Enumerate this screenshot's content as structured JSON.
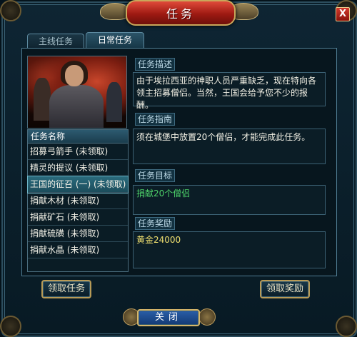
{
  "window": {
    "title": "任务",
    "close_label": "X"
  },
  "tabs": [
    {
      "label": "主线任务",
      "active": false
    },
    {
      "label": "日常任务",
      "active": true
    }
  ],
  "quest_list": {
    "header": "任务名称",
    "items": [
      {
        "label": "招募弓箭手 (未领取)",
        "selected": false
      },
      {
        "label": "精灵的提议 (未领取)",
        "selected": false
      },
      {
        "label": "王国的征召 (一) (未领取)",
        "selected": true
      },
      {
        "label": "捐献木材 (未领取)",
        "selected": false
      },
      {
        "label": "捐献矿石 (未领取)",
        "selected": false
      },
      {
        "label": "捐献硫磺 (未领取)",
        "selected": false
      },
      {
        "label": "捐献水晶 (未领取)",
        "selected": false
      }
    ]
  },
  "details": {
    "description_label": "任务描述",
    "description_text": "由于埃拉西亚的神职人员严重缺乏，现在特向各领主招募僧侣。当然，王国会给予您不少的报酬。",
    "guide_label": "任务指南",
    "guide_text": "须在城堡中放置20个僧侣，才能完成此任务。",
    "goal_label": "任务目标",
    "goal_text": "捐献20个僧侣",
    "reward_label": "任务奖励",
    "reward_text": "黄金24000"
  },
  "buttons": {
    "accept": "领取任务",
    "claim_reward": "领取奖励",
    "close": "关闭"
  },
  "colors": {
    "title_red": "#b32418",
    "selected_row": "#2a6b7d",
    "goal_green": "#4ed36a",
    "reward_yellow": "#f0e070",
    "gold_trim": "#c9a75a"
  }
}
